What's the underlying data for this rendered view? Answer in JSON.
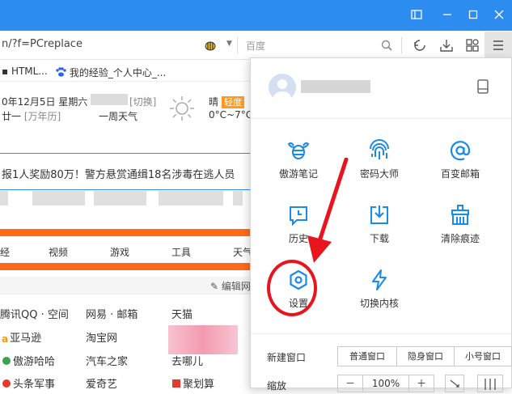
{
  "address_bar": {
    "url": "n/?f=PCreplace",
    "search_placeholder": "百度"
  },
  "bookmarks": [
    {
      "label": "HTML..."
    },
    {
      "label": "我的经验_个人中心_..."
    }
  ],
  "page": {
    "date": "0年12月5日 星期六",
    "switch": "[切换]",
    "lunar": "廿一",
    "lunar_link": "[万年历]",
    "week_weather": "一周天气",
    "weather": "晴",
    "aqi": "轻度",
    "temperature": "0°C~7°C",
    "news": "报1人奖励80万！警方悬赏通缉18名涉毒在逃人员",
    "nav_items": [
      "经",
      "视频",
      "游戏",
      "工具",
      "天气"
    ],
    "edit_nav": "编辑网",
    "sites": [
      [
        "腾讯QQ · 空间",
        "网易 · 邮箱",
        "天猫"
      ],
      [
        "亚马逊",
        "淘宝网",
        ""
      ],
      [
        "傲游哈哈",
        "汽车之家",
        "去哪儿"
      ],
      [
        "头条军事",
        "爱奇艺",
        "聚划算"
      ]
    ]
  },
  "menu": {
    "items": [
      {
        "label": "傲游笔记",
        "icon": "bee-notes-icon"
      },
      {
        "label": "密码大师",
        "icon": "fingerprint-icon"
      },
      {
        "label": "百变邮箱",
        "icon": "at-mail-icon"
      },
      {
        "label": "历史",
        "icon": "history-icon"
      },
      {
        "label": "下载",
        "icon": "download-icon"
      },
      {
        "label": "清除痕迹",
        "icon": "broom-icon"
      },
      {
        "label": "设置",
        "icon": "gear-icon"
      },
      {
        "label": "切换内核",
        "icon": "lightning-icon"
      }
    ],
    "new_window_label": "新建窗口",
    "window_buttons": [
      "普通窗口",
      "隐身窗口",
      "小号窗口"
    ],
    "zoom_label": "缩放",
    "zoom_minus": "－",
    "zoom_value": "100%",
    "zoom_plus": "＋"
  },
  "colors": {
    "title_bar": "#2d8cf0",
    "menu_icon": "#1a8be8",
    "annotation": "#e8141e",
    "accent_orange": "#ff6a1a"
  }
}
